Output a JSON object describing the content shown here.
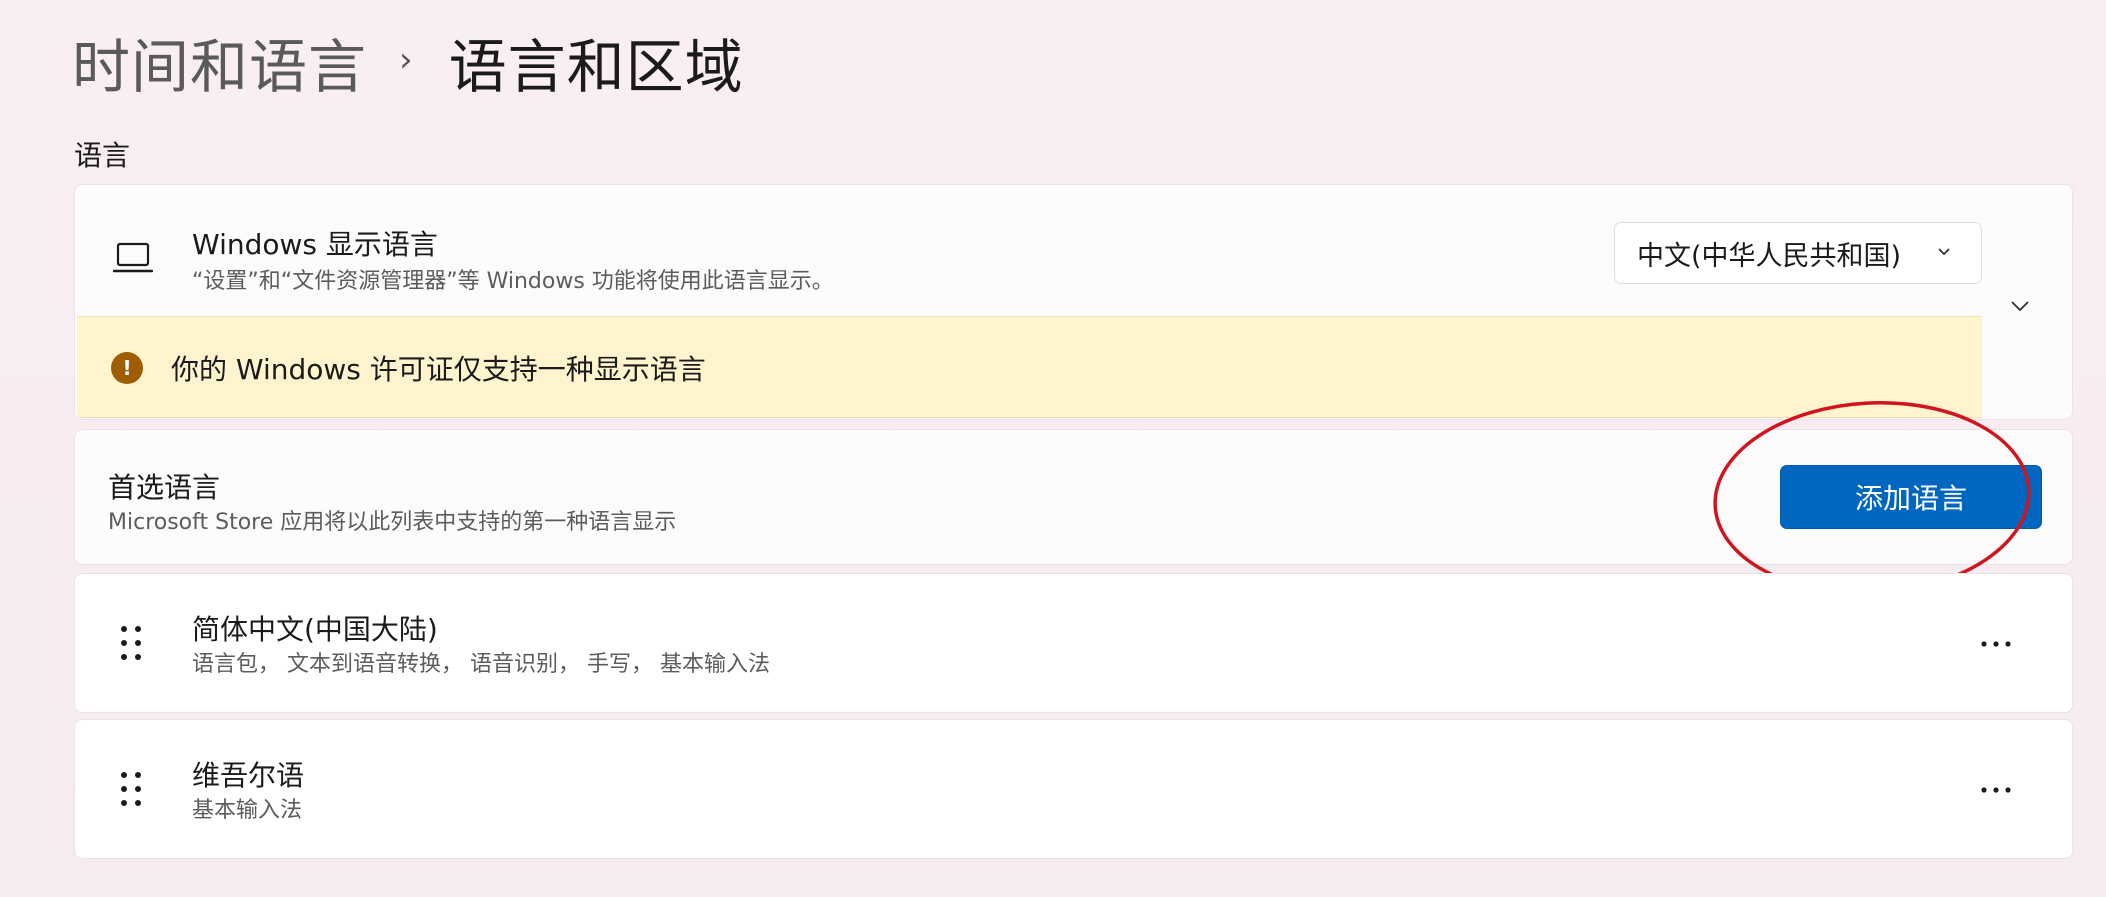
{
  "breadcrumb": {
    "parent": "时间和语言",
    "separator": "›",
    "current": "语言和区域"
  },
  "section": {
    "title": "语言"
  },
  "display_language": {
    "icon": "laptop-icon",
    "title": "Windows 显示语言",
    "description": "“设置”和“文件资源管理器”等 Windows 功能将使用此语言显示。",
    "selected": "中文(中华人民共和国)",
    "warning_icon": "warning-icon",
    "warning": "你的 Windows 许可证仅支持一种显示语言"
  },
  "preferred_languages": {
    "title": "首选语言",
    "description": "Microsoft Store 应用将以此列表中支持的第一种语言显示",
    "add_button": "添加语言"
  },
  "languages": [
    {
      "name": "简体中文(中国大陆)",
      "features": "语言包， 文本到语音转换， 语音识别， 手写， 基本输入法"
    },
    {
      "name": "维吾尔语",
      "features": "基本输入法"
    }
  ],
  "colors": {
    "accent": "#0067c0",
    "warning_bg": "#fff4ce",
    "warning_icon": "#9d5d00",
    "annotation": "#d0151f"
  }
}
